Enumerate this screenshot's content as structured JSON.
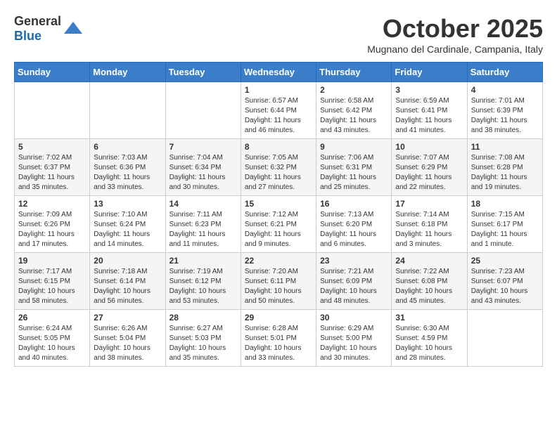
{
  "header": {
    "logo_general": "General",
    "logo_blue": "Blue",
    "month_title": "October 2025",
    "location": "Mugnano del Cardinale, Campania, Italy"
  },
  "weekdays": [
    "Sunday",
    "Monday",
    "Tuesday",
    "Wednesday",
    "Thursday",
    "Friday",
    "Saturday"
  ],
  "weeks": [
    [
      {
        "day": "",
        "info": ""
      },
      {
        "day": "",
        "info": ""
      },
      {
        "day": "",
        "info": ""
      },
      {
        "day": "1",
        "info": "Sunrise: 6:57 AM\nSunset: 6:44 PM\nDaylight: 11 hours\nand 46 minutes."
      },
      {
        "day": "2",
        "info": "Sunrise: 6:58 AM\nSunset: 6:42 PM\nDaylight: 11 hours\nand 43 minutes."
      },
      {
        "day": "3",
        "info": "Sunrise: 6:59 AM\nSunset: 6:41 PM\nDaylight: 11 hours\nand 41 minutes."
      },
      {
        "day": "4",
        "info": "Sunrise: 7:01 AM\nSunset: 6:39 PM\nDaylight: 11 hours\nand 38 minutes."
      }
    ],
    [
      {
        "day": "5",
        "info": "Sunrise: 7:02 AM\nSunset: 6:37 PM\nDaylight: 11 hours\nand 35 minutes."
      },
      {
        "day": "6",
        "info": "Sunrise: 7:03 AM\nSunset: 6:36 PM\nDaylight: 11 hours\nand 33 minutes."
      },
      {
        "day": "7",
        "info": "Sunrise: 7:04 AM\nSunset: 6:34 PM\nDaylight: 11 hours\nand 30 minutes."
      },
      {
        "day": "8",
        "info": "Sunrise: 7:05 AM\nSunset: 6:32 PM\nDaylight: 11 hours\nand 27 minutes."
      },
      {
        "day": "9",
        "info": "Sunrise: 7:06 AM\nSunset: 6:31 PM\nDaylight: 11 hours\nand 25 minutes."
      },
      {
        "day": "10",
        "info": "Sunrise: 7:07 AM\nSunset: 6:29 PM\nDaylight: 11 hours\nand 22 minutes."
      },
      {
        "day": "11",
        "info": "Sunrise: 7:08 AM\nSunset: 6:28 PM\nDaylight: 11 hours\nand 19 minutes."
      }
    ],
    [
      {
        "day": "12",
        "info": "Sunrise: 7:09 AM\nSunset: 6:26 PM\nDaylight: 11 hours\nand 17 minutes."
      },
      {
        "day": "13",
        "info": "Sunrise: 7:10 AM\nSunset: 6:24 PM\nDaylight: 11 hours\nand 14 minutes."
      },
      {
        "day": "14",
        "info": "Sunrise: 7:11 AM\nSunset: 6:23 PM\nDaylight: 11 hours\nand 11 minutes."
      },
      {
        "day": "15",
        "info": "Sunrise: 7:12 AM\nSunset: 6:21 PM\nDaylight: 11 hours\nand 9 minutes."
      },
      {
        "day": "16",
        "info": "Sunrise: 7:13 AM\nSunset: 6:20 PM\nDaylight: 11 hours\nand 6 minutes."
      },
      {
        "day": "17",
        "info": "Sunrise: 7:14 AM\nSunset: 6:18 PM\nDaylight: 11 hours\nand 3 minutes."
      },
      {
        "day": "18",
        "info": "Sunrise: 7:15 AM\nSunset: 6:17 PM\nDaylight: 11 hours\nand 1 minute."
      }
    ],
    [
      {
        "day": "19",
        "info": "Sunrise: 7:17 AM\nSunset: 6:15 PM\nDaylight: 10 hours\nand 58 minutes."
      },
      {
        "day": "20",
        "info": "Sunrise: 7:18 AM\nSunset: 6:14 PM\nDaylight: 10 hours\nand 56 minutes."
      },
      {
        "day": "21",
        "info": "Sunrise: 7:19 AM\nSunset: 6:12 PM\nDaylight: 10 hours\nand 53 minutes."
      },
      {
        "day": "22",
        "info": "Sunrise: 7:20 AM\nSunset: 6:11 PM\nDaylight: 10 hours\nand 50 minutes."
      },
      {
        "day": "23",
        "info": "Sunrise: 7:21 AM\nSunset: 6:09 PM\nDaylight: 10 hours\nand 48 minutes."
      },
      {
        "day": "24",
        "info": "Sunrise: 7:22 AM\nSunset: 6:08 PM\nDaylight: 10 hours\nand 45 minutes."
      },
      {
        "day": "25",
        "info": "Sunrise: 7:23 AM\nSunset: 6:07 PM\nDaylight: 10 hours\nand 43 minutes."
      }
    ],
    [
      {
        "day": "26",
        "info": "Sunrise: 6:24 AM\nSunset: 5:05 PM\nDaylight: 10 hours\nand 40 minutes."
      },
      {
        "day": "27",
        "info": "Sunrise: 6:26 AM\nSunset: 5:04 PM\nDaylight: 10 hours\nand 38 minutes."
      },
      {
        "day": "28",
        "info": "Sunrise: 6:27 AM\nSunset: 5:03 PM\nDaylight: 10 hours\nand 35 minutes."
      },
      {
        "day": "29",
        "info": "Sunrise: 6:28 AM\nSunset: 5:01 PM\nDaylight: 10 hours\nand 33 minutes."
      },
      {
        "day": "30",
        "info": "Sunrise: 6:29 AM\nSunset: 5:00 PM\nDaylight: 10 hours\nand 30 minutes."
      },
      {
        "day": "31",
        "info": "Sunrise: 6:30 AM\nSunset: 4:59 PM\nDaylight: 10 hours\nand 28 minutes."
      },
      {
        "day": "",
        "info": ""
      }
    ]
  ]
}
